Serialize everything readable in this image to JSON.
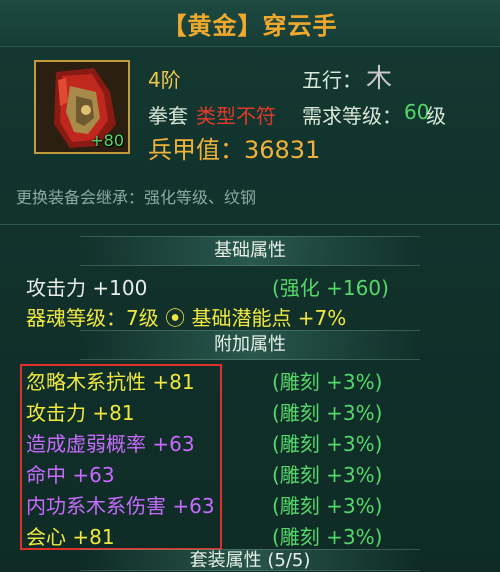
{
  "title": "【黄金】穿云手",
  "item": {
    "icon": "gauntlet-icon",
    "plus_level": "+80",
    "tier": "4阶",
    "wuxing_label": "五行：",
    "wuxing_value": "木",
    "type": "拳套",
    "type_warning": "类型不符",
    "req_label": "需求等级：",
    "req_level": "60",
    "req_unit": "级",
    "power": "兵甲值：36831",
    "inherit_note": "更换装备会继承：强化等级、纹钢"
  },
  "sections": {
    "base": "基础属性",
    "extra": "附加属性",
    "set": "套装属性 (5/5)"
  },
  "base_stats": [
    {
      "left": "攻击力  +100",
      "right": "(强化 +160)"
    },
    {
      "left": "器魂等级：7级  ⦿  基础潜能点  +7%"
    }
  ],
  "extra_stats": [
    {
      "name": "忽略木系抗性  +81",
      "color": "yellow",
      "bonus": "(雕刻 +3%)"
    },
    {
      "name": "攻击力  +81",
      "color": "yellow",
      "bonus": "(雕刻 +3%)"
    },
    {
      "name": "造成虚弱概率  +63",
      "color": "purple",
      "bonus": "(雕刻 +3%)"
    },
    {
      "name": "命中  +63",
      "color": "purple",
      "bonus": "(雕刻 +3%)"
    },
    {
      "name": "内功系木系伤害  +63",
      "color": "purple",
      "bonus": "(雕刻 +3%)"
    },
    {
      "name": "会心  +81",
      "color": "yellow",
      "bonus": "(雕刻 +3%)"
    }
  ],
  "colors": {
    "gold": "#f0a92d",
    "green": "#54d86a",
    "red": "#e23a2a",
    "yellow": "#f0e840",
    "purple": "#c76bff"
  }
}
